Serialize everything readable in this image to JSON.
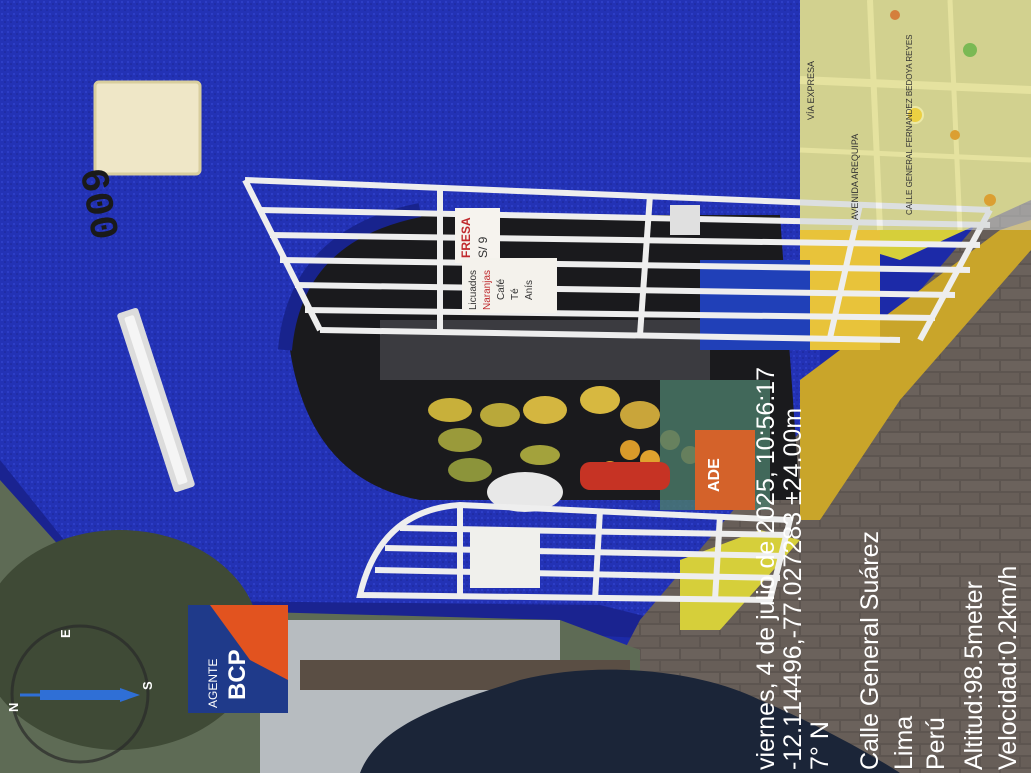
{
  "house_number": "600",
  "agent_sign": {
    "line1": "AGENTE",
    "line2": "BCP"
  },
  "shop_signs": {
    "fresa": "FRESA",
    "fresa_price": "S/ 9",
    "menu_line1": "Licuados",
    "menu_line2": "Naranjas",
    "menu_line3": "Café",
    "menu_line4": "Té",
    "menu_line5": "Anís",
    "brand": "ADE"
  },
  "gps_stamp": {
    "line1": "viernes, 4 de julio de 2025, 10:56:17",
    "line2": "-12.114496,-77.027283 ±24.00m",
    "line3": "7° N",
    "line4": "Calle General Suárez",
    "line5": "Lima",
    "line6": "Perú",
    "line7": "Altitud:98.5meter",
    "line8": "Velocidad:0.2km/h"
  },
  "compass": {
    "n": "N",
    "e": "E",
    "s": "S"
  },
  "mini_map": {
    "street1": "AVENIDA AREQUIPA",
    "street2": "CALLE GENERAL FERNANDEZ BEDOYA REYES",
    "street3": "VÍA EXPRESA"
  }
}
